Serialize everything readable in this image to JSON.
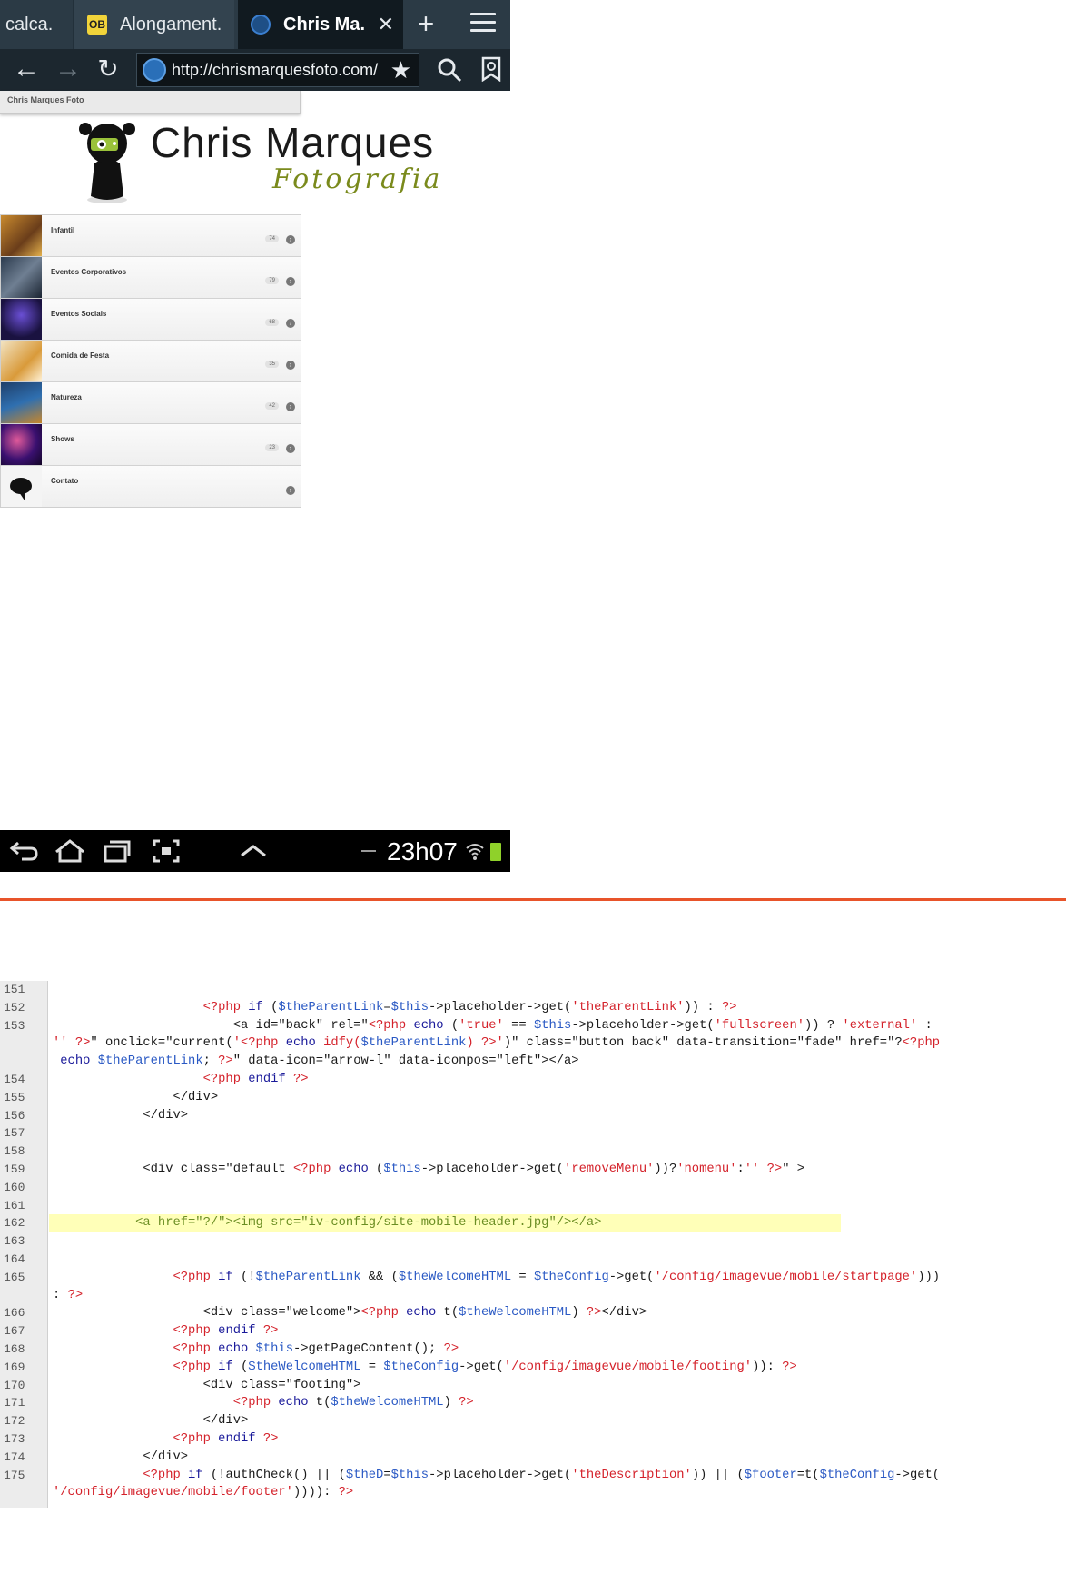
{
  "browser": {
    "tabs": [
      {
        "label": "calca."
      },
      {
        "label": "Alongament."
      },
      {
        "label": "Chris Ma."
      }
    ],
    "url": "http://chrismarquesfoto.com/"
  },
  "page": {
    "header_title": "Chris Marques Foto",
    "logo_name": "Chris Marques",
    "logo_sub": "Fotografia",
    "galleries": [
      {
        "label": "Infantil",
        "count": "74"
      },
      {
        "label": "Eventos Corporativos",
        "count": "79"
      },
      {
        "label": "Eventos Sociais",
        "count": "68"
      },
      {
        "label": "Comida de Festa",
        "count": "35"
      },
      {
        "label": "Natureza",
        "count": "42"
      },
      {
        "label": "Shows",
        "count": "23"
      },
      {
        "label": "Contato",
        "count": ""
      }
    ]
  },
  "status_bar": {
    "time": "23h07"
  },
  "code": {
    "lines": [
      {
        "num": "151",
        "text": ""
      },
      {
        "num": "152",
        "text": "                    <?php if ($theParentLink=$this->placeholder->get('theParentLink')) : ?>"
      },
      {
        "num": "153",
        "text": "                        <a id=\"back\" rel=\"<?php echo ('true' == $this->placeholder->get('fullscreen')) ? 'external' :"
      },
      {
        "num": "",
        "text": "'' ?>\" onclick=\"current('<?php echo idfy($theParentLink) ?>')\" class=\"button back\" data-transition=\"fade\" href=\"?<?php"
      },
      {
        "num": "",
        "text": " echo $theParentLink; ?>\" data-icon=\"arrow-l\" data-iconpos=\"left\"></a>"
      },
      {
        "num": "154",
        "text": "                    <?php endif ?>"
      },
      {
        "num": "155",
        "text": "                </div>"
      },
      {
        "num": "156",
        "text": "            </div>"
      },
      {
        "num": "157",
        "text": ""
      },
      {
        "num": "158",
        "text": ""
      },
      {
        "num": "159",
        "text": "            <div class=\"default <?php echo ($this->placeholder->get('removeMenu'))?'nomenu':'' ?>\" >"
      },
      {
        "num": "160",
        "text": ""
      },
      {
        "num": "161",
        "text": ""
      },
      {
        "num": "162",
        "text": "           <a href=\"?/\"><img src=\"iv-config/site-mobile-header.jpg\"/></a>"
      },
      {
        "num": "163",
        "text": ""
      },
      {
        "num": "164",
        "text": ""
      },
      {
        "num": "165",
        "text": "                <?php if (!$theParentLink && ($theWelcomeHTML = $theConfig->get('/config/imagevue/mobile/startpage')))"
      },
      {
        "num": "",
        "text": ": ?>"
      },
      {
        "num": "166",
        "text": "                    <div class=\"welcome\"><?php echo t($theWelcomeHTML) ?></div>"
      },
      {
        "num": "167",
        "text": "                <?php endif ?>"
      },
      {
        "num": "168",
        "text": "                <?php echo $this->getPageContent(); ?>"
      },
      {
        "num": "169",
        "text": "                <?php if ($theWelcomeHTML = $theConfig->get('/config/imagevue/mobile/footing')): ?>"
      },
      {
        "num": "170",
        "text": "                    <div class=\"footing\">"
      },
      {
        "num": "171",
        "text": "                        <?php echo t($theWelcomeHTML) ?>"
      },
      {
        "num": "172",
        "text": "                    </div>"
      },
      {
        "num": "173",
        "text": "                <?php endif ?>"
      },
      {
        "num": "174",
        "text": "            </div>"
      },
      {
        "num": "175",
        "text": "            <?php if (!authCheck() || ($theD=$this->placeholder->get('theDescription')) || ($footer=t($theConfig->get("
      },
      {
        "num": "",
        "text": "'/config/imagevue/mobile/footer')))): ?>"
      }
    ],
    "highlighted_line": "162"
  }
}
